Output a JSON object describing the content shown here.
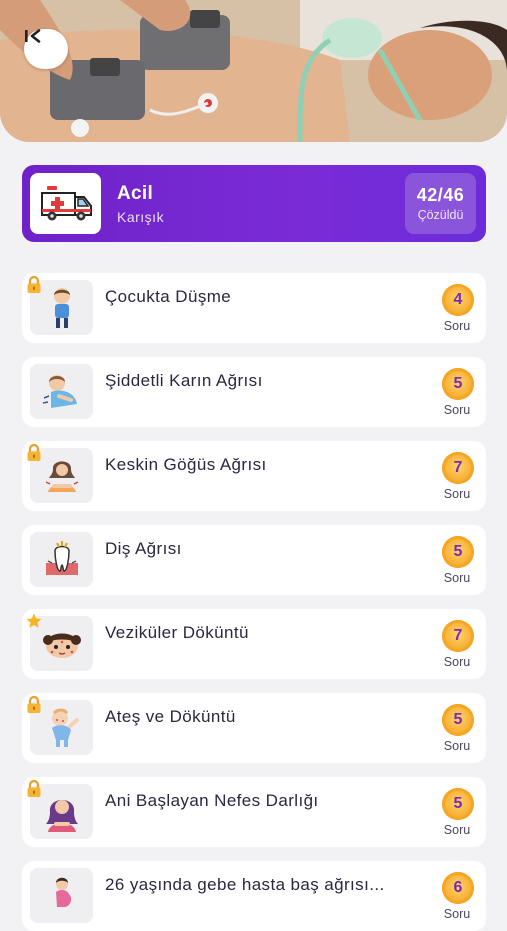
{
  "header": {
    "back_icon": "back-arrow-icon"
  },
  "category": {
    "title": "Acil",
    "subtitle": "Karışık",
    "icon": "ambulance-icon",
    "progress": "42/46",
    "progress_label": "Çözüldü",
    "gradient_start": "#6f22c9",
    "gradient_end": "#6b2cd9"
  },
  "lessons": [
    {
      "title": "Çocukta Düşme",
      "count": "4",
      "count_label": "Soru",
      "badge": "lock",
      "thumb": "child-icon"
    },
    {
      "title": "Şiddetli Karın Ağrısı",
      "count": "5",
      "count_label": "Soru",
      "badge": "",
      "thumb": "abdominal-pain-icon"
    },
    {
      "title": "Keskin Göğüs Ağrısı",
      "count": "7",
      "count_label": "Soru",
      "badge": "lock",
      "thumb": "chest-pain-icon"
    },
    {
      "title": "Diş Ağrısı",
      "count": "5",
      "count_label": "Soru",
      "badge": "",
      "thumb": "tooth-icon"
    },
    {
      "title": "Veziküler Döküntü",
      "count": "7",
      "count_label": "Soru",
      "badge": "star",
      "thumb": "rash-face-icon"
    },
    {
      "title": "Ateş ve Döküntü",
      "count": "5",
      "count_label": "Soru",
      "badge": "lock",
      "thumb": "baby-icon"
    },
    {
      "title": "Ani Başlayan Nefes Darlığı",
      "count": "5",
      "count_label": "Soru",
      "badge": "lock",
      "thumb": "breathless-woman-icon"
    },
    {
      "title": "26 yaşında gebe hasta baş ağrısı...",
      "count": "6",
      "count_label": "Soru",
      "badge": "",
      "thumb": "pregnant-woman-icon"
    }
  ],
  "colors": {
    "accent": "#7a2bd6",
    "coin": "#f7b23a",
    "count_text": "#7b2ab8",
    "background": "#f2f1f4"
  }
}
